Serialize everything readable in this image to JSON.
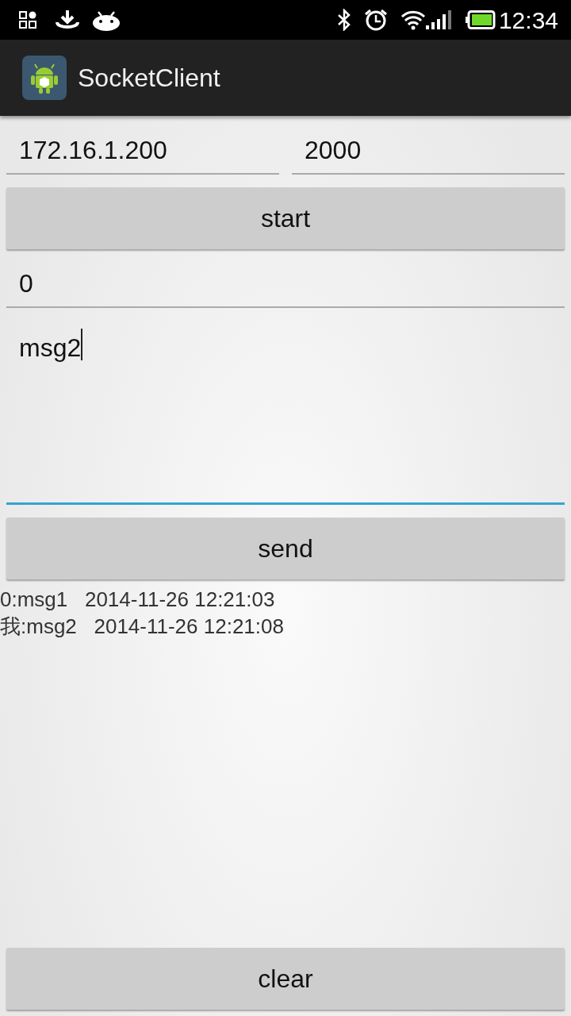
{
  "status_bar": {
    "time": "12:34"
  },
  "app_bar": {
    "title": "SocketClient"
  },
  "host_field": {
    "value": "172.16.1.200"
  },
  "port_field": {
    "value": "2000"
  },
  "start_button": {
    "label": "start"
  },
  "target_field": {
    "value": "0"
  },
  "message_field": {
    "value": "msg2",
    "focused": true
  },
  "send_button": {
    "label": "send"
  },
  "log": [
    "0:msg1   2014-11-26 12:21:03",
    "我:msg2   2014-11-26 12:21:08"
  ],
  "clear_button": {
    "label": "clear"
  }
}
